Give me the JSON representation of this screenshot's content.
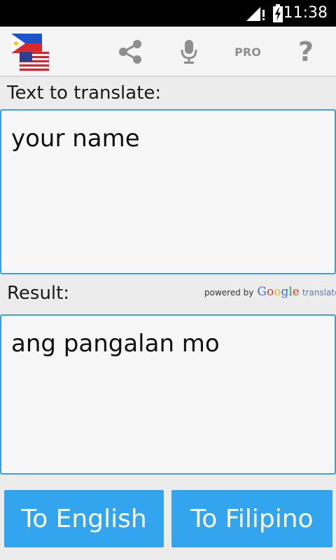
{
  "status_bar": {
    "time": "11:38",
    "signal_icon": "signal-icon",
    "battery_icon": "battery-charging-icon"
  },
  "action_bar": {
    "flags_icon": "ph-us-flags-icon",
    "share_icon": "share-icon",
    "mic_icon": "microphone-icon",
    "pro_label": "PRO",
    "help_label": "?"
  },
  "input": {
    "label": "Text to translate:",
    "value": "your name"
  },
  "result": {
    "label": "Result:",
    "value": "ang pangalan mo"
  },
  "powered_by": {
    "prefix": "powered by",
    "google": [
      {
        "ch": "G",
        "color": "#3c6fd6"
      },
      {
        "ch": "o",
        "color": "#d93a2b"
      },
      {
        "ch": "o",
        "color": "#f0b400"
      },
      {
        "ch": "g",
        "color": "#3c6fd6"
      },
      {
        "ch": "l",
        "color": "#27a047"
      },
      {
        "ch": "e",
        "color": "#d93a2b"
      }
    ],
    "suffix": "translate"
  },
  "buttons": {
    "to_english": "To English",
    "to_filipino": "To Filipino"
  },
  "colors": {
    "accent": "#33a5ef",
    "border": "#3aa0e6"
  }
}
